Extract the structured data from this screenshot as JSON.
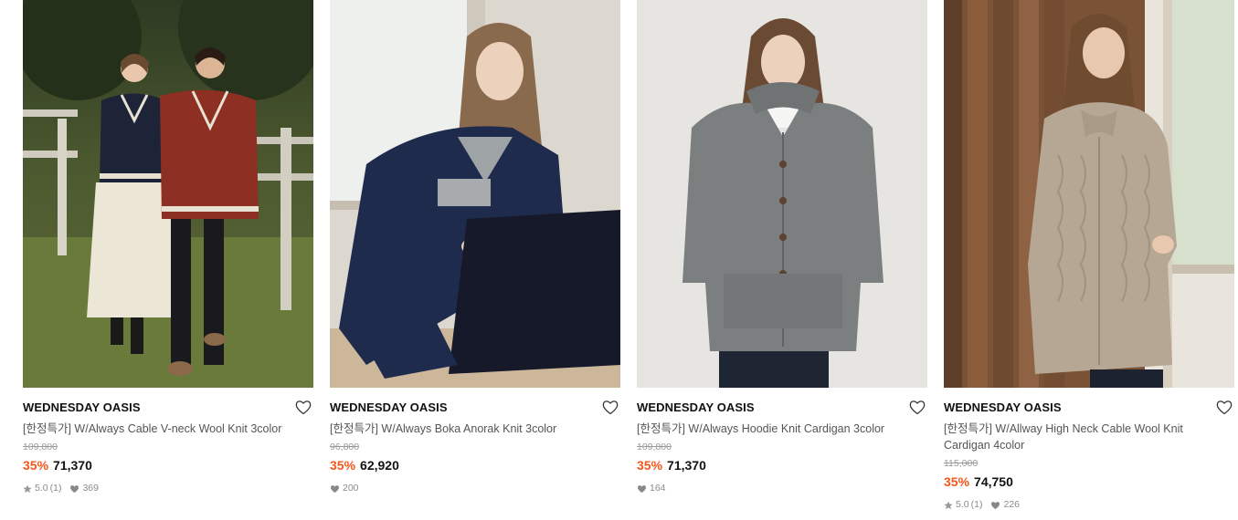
{
  "products": [
    {
      "brand": "WEDNESDAY OASIS",
      "title": "[한정특가] W/Always Cable V-neck Wool Knit 3color",
      "original_price": "109,800",
      "discount": "35%",
      "price": "71,370",
      "rating": "5.0",
      "review_count": "(1)",
      "likes": "369"
    },
    {
      "brand": "WEDNESDAY OASIS",
      "title": "[한정특가] W/Always Boka Anorak Knit 3color",
      "original_price": "96,800",
      "discount": "35%",
      "price": "62,920",
      "likes": "200"
    },
    {
      "brand": "WEDNESDAY OASIS",
      "title": "[한정특가] W/Always Hoodie Knit Cardigan 3color",
      "original_price": "109,800",
      "discount": "35%",
      "price": "71,370",
      "likes": "164"
    },
    {
      "brand": "WEDNESDAY OASIS",
      "title": "[한정특가] W/Allway High Neck Cable Wool Knit Cardigan 4color",
      "original_price": "115,000",
      "discount": "35%",
      "price": "74,750",
      "rating": "5.0",
      "review_count": "(1)",
      "likes": "226"
    }
  ],
  "colors": {
    "discount": "#f2561d",
    "brand_text": "#111111",
    "muted": "#8a8a8a"
  },
  "icons": {
    "wishlist": "heart-outline-icon",
    "likes": "heart-filled-icon",
    "rating": "star-icon"
  }
}
